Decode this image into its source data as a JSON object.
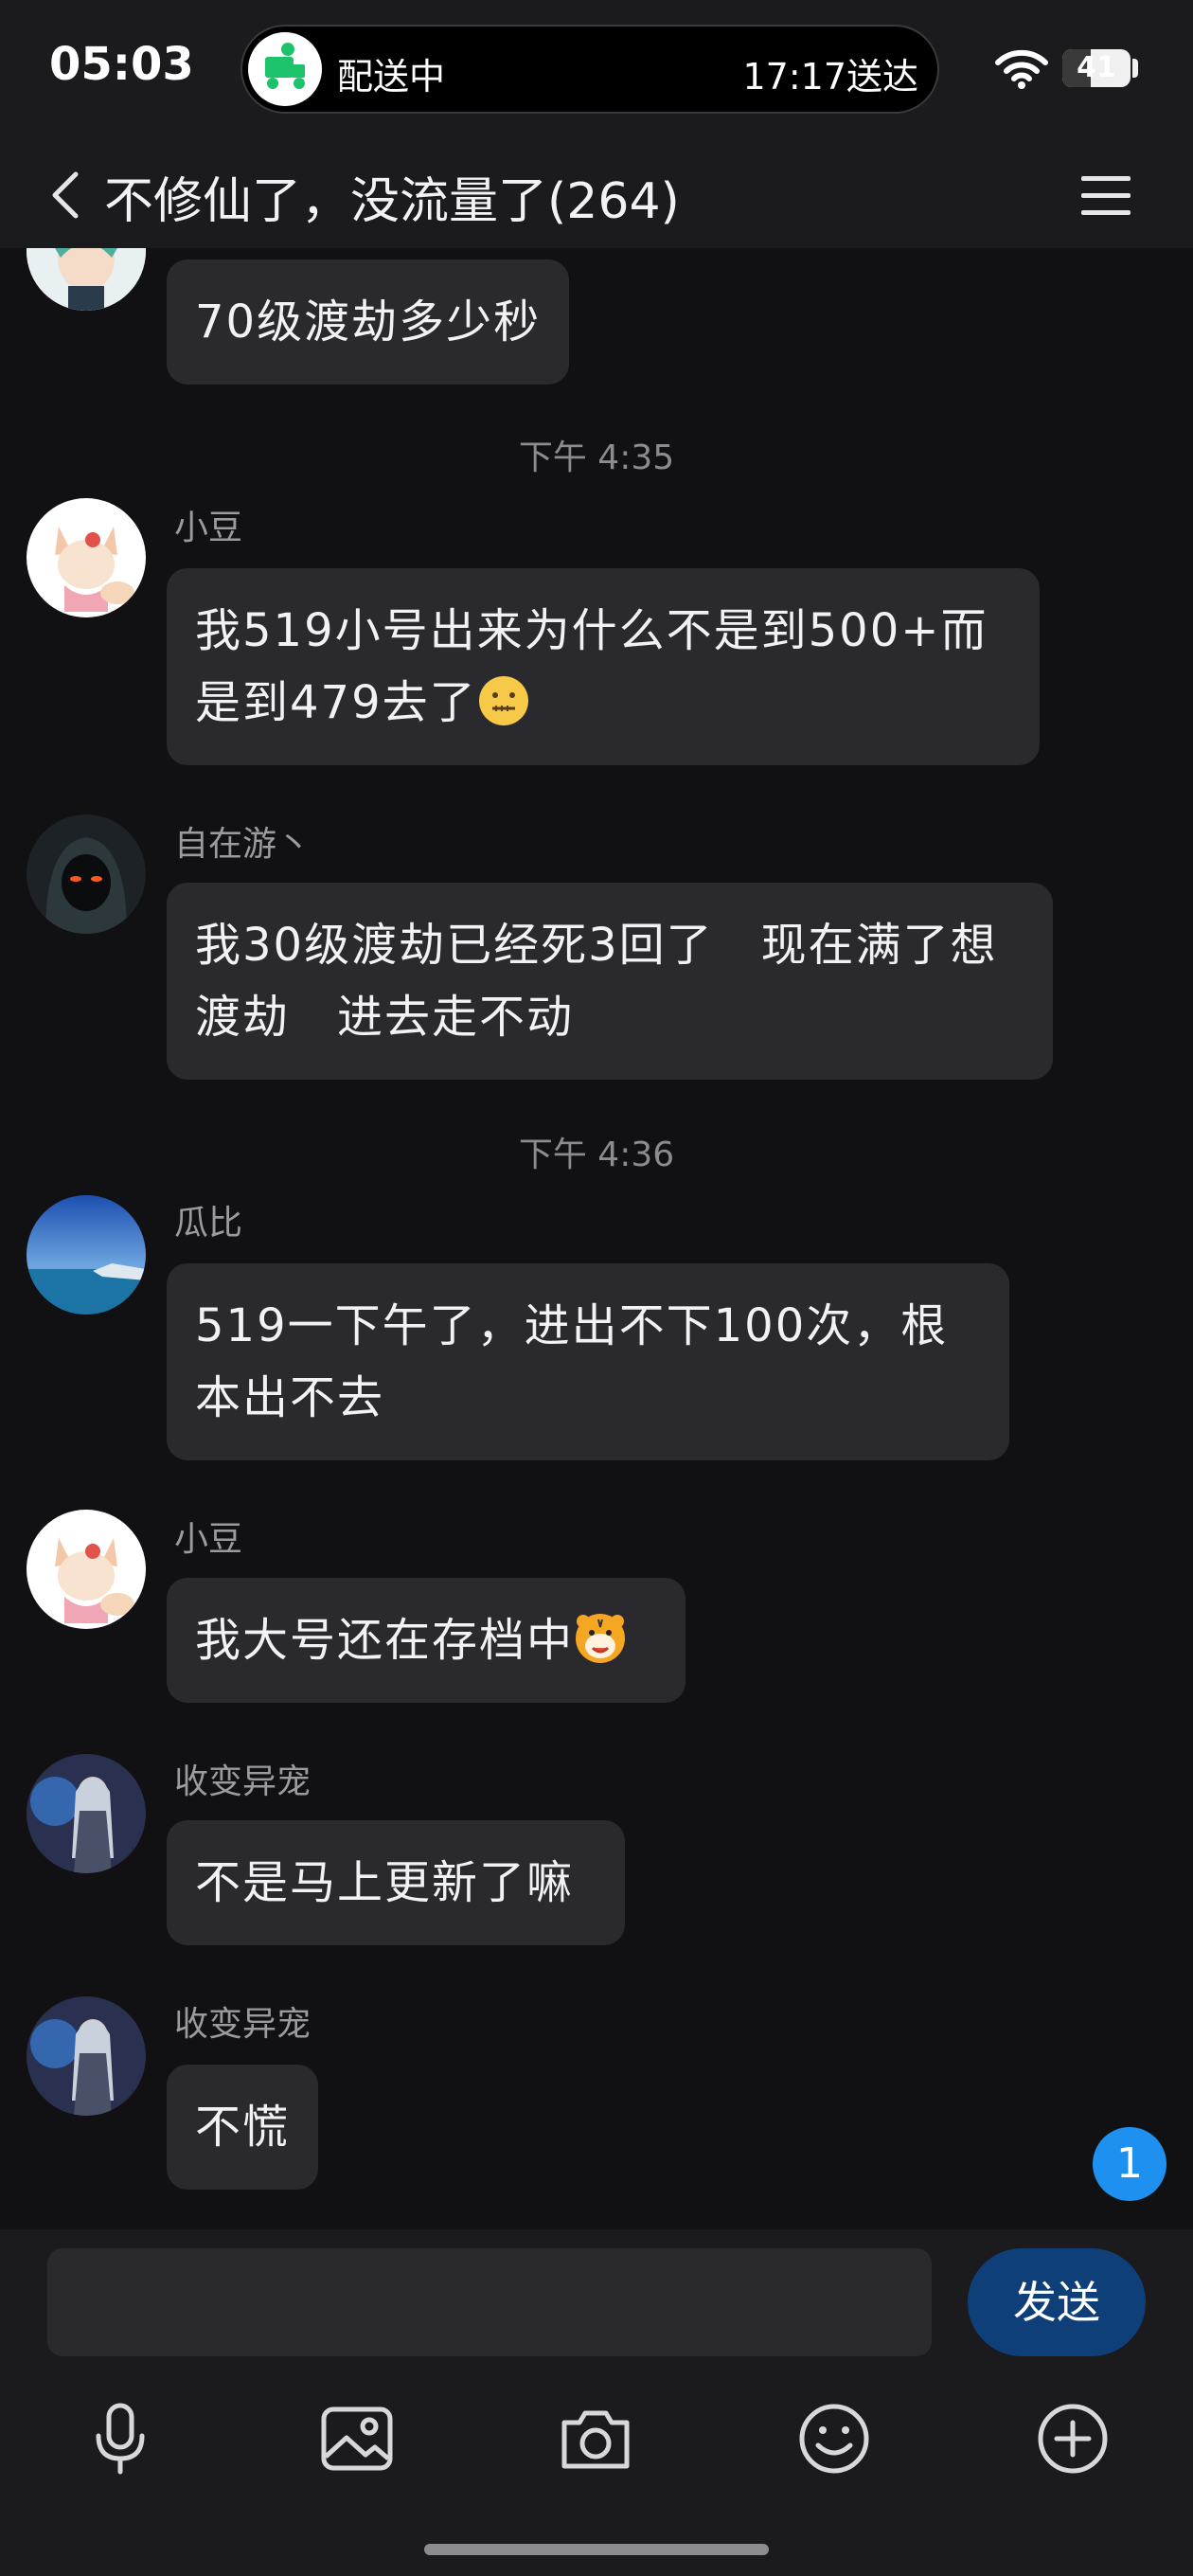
{
  "status_bar": {
    "time": "05:03",
    "live_activity_left": "配送中",
    "live_activity_right": "17:17送达",
    "battery": "41"
  },
  "header": {
    "title": "不修仙了，没流量了(264)"
  },
  "messages": [
    {
      "sender": "",
      "text": "70级渡劫多少秒"
    },
    {
      "time": "下午 4:35"
    },
    {
      "sender": "小豆",
      "text": "我519小号出来为什么不是到500+而是到479去了",
      "emoji": "zipper-mouth-face"
    },
    {
      "sender": "自在游丶",
      "text": "我30级渡劫已经死3回了　现在满了想渡劫　进去走不动"
    },
    {
      "time": "下午 4:36"
    },
    {
      "sender": "瓜比",
      "text": "519一下午了，进出不下100次，根本出不去"
    },
    {
      "sender": "小豆",
      "text": "我大号还在存档中",
      "emoji": "tiger-face"
    },
    {
      "sender": "收变异宠",
      "text": "不是马上更新了嘛"
    },
    {
      "sender": "收变异宠",
      "text": "不慌"
    }
  ],
  "unread_badge": "1",
  "composer": {
    "input_value": "",
    "send_label": "发送"
  },
  "colors": {
    "background": "#111114",
    "bubble": "#2a2a2e",
    "accent": "#1e90f0",
    "send_button": "#0f3f78"
  }
}
